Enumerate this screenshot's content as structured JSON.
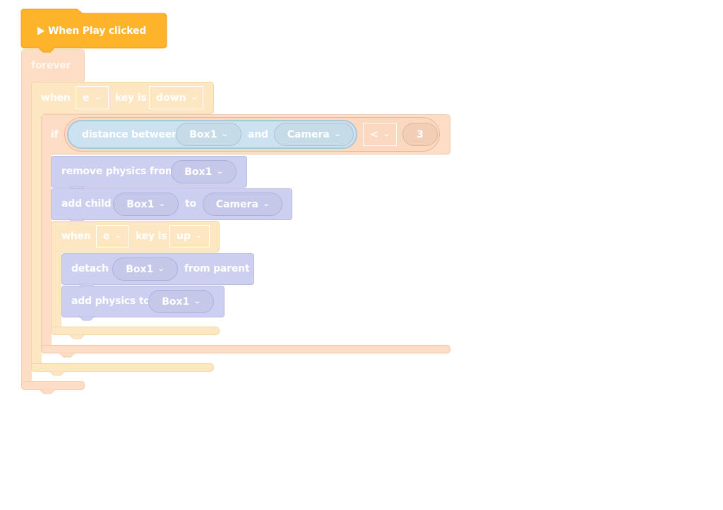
{
  "script": {
    "event_block": {
      "icon": "play-triangle-icon",
      "label": "When Play clicked",
      "color": "#fdb32a"
    },
    "forever_block": {
      "label": "forever",
      "color": "#fdddc5"
    },
    "when_key_down": {
      "prefix": "when",
      "key": "e",
      "middle": "key is",
      "state": "down",
      "color": "#fde7c3"
    },
    "if_block": {
      "prefix": "if",
      "condition": {
        "sensor_label": "distance between",
        "object_a": "Box1",
        "conjunction": "and",
        "object_b": "Camera",
        "operator": "<",
        "value": "3"
      },
      "color": "#fdddc5"
    },
    "remove_physics": {
      "label": "remove physics from",
      "object": "Box1",
      "color": "#cdcff0"
    },
    "add_child": {
      "label": "add child",
      "object": "Box1",
      "connector": "to",
      "target": "Camera"
    },
    "when_key_up": {
      "prefix": "when",
      "key": "e",
      "middle": "key is",
      "state": "up"
    },
    "detach": {
      "label": "detach",
      "object": "Box1",
      "suffix": "from parent"
    },
    "add_physics": {
      "label": "add physics to",
      "object": "Box1"
    },
    "dropdown_chevron": "⌄"
  }
}
